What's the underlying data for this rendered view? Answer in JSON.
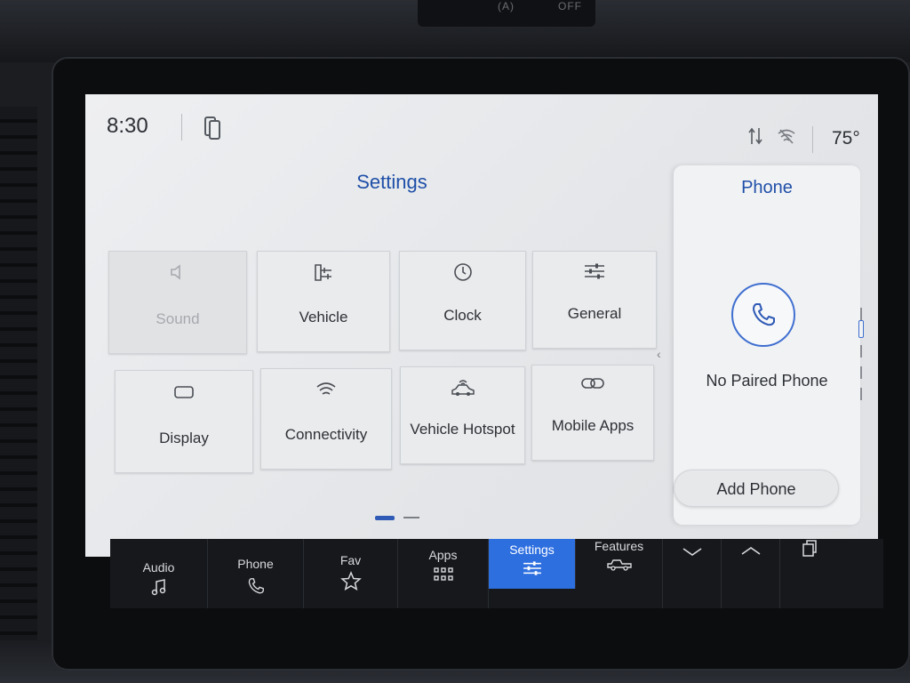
{
  "hardware": {
    "knob_left": "(A)",
    "knob_right": "OFF"
  },
  "status_bar": {
    "time": "8:30",
    "temperature": "75°",
    "icons": [
      "phone-projection-icon",
      "data-transfer-icon",
      "wifi-off-icon"
    ]
  },
  "settings": {
    "title": "Settings",
    "tiles": [
      {
        "label": "Sound",
        "icon": "speaker-icon",
        "enabled": false
      },
      {
        "label": "Vehicle",
        "icon": "vehicle-settings-icon",
        "enabled": true
      },
      {
        "label": "Clock",
        "icon": "clock-icon",
        "enabled": true
      },
      {
        "label": "General",
        "icon": "sliders-icon",
        "enabled": true
      },
      {
        "label": "Display",
        "icon": "display-icon",
        "enabled": true
      },
      {
        "label": "Connectivity",
        "icon": "wifi-icon",
        "enabled": true
      },
      {
        "label": "Vehicle Hotspot",
        "icon": "car-wifi-icon",
        "enabled": true
      },
      {
        "label": "Mobile Apps",
        "icon": "link-icon",
        "enabled": true
      }
    ],
    "page": {
      "current": 1,
      "total": 2
    }
  },
  "phone_panel": {
    "title": "Phone",
    "status": "No Paired Phone",
    "add_button": "Add Phone"
  },
  "nav": {
    "items": [
      {
        "label": "Audio",
        "icon": "music-note-icon",
        "active": false
      },
      {
        "label": "Phone",
        "icon": "phone-icon",
        "active": false
      },
      {
        "label": "Fav",
        "icon": "star-icon",
        "active": false
      },
      {
        "label": "Apps",
        "icon": "grid-icon",
        "active": false
      },
      {
        "label": "Settings",
        "icon": "sliders-icon",
        "active": true
      },
      {
        "label": "Features",
        "icon": "truck-icon",
        "active": false
      },
      {
        "label": "",
        "icon": "chevron-down-icon",
        "active": false
      },
      {
        "label": "",
        "icon": "chevron-up-icon",
        "active": false
      },
      {
        "label": "",
        "icon": "copy-windows-icon",
        "active": false
      }
    ]
  },
  "colors": {
    "accent": "#2e6fe0",
    "title_blue": "#1f4fa8",
    "nav_bg": "#16181b"
  }
}
